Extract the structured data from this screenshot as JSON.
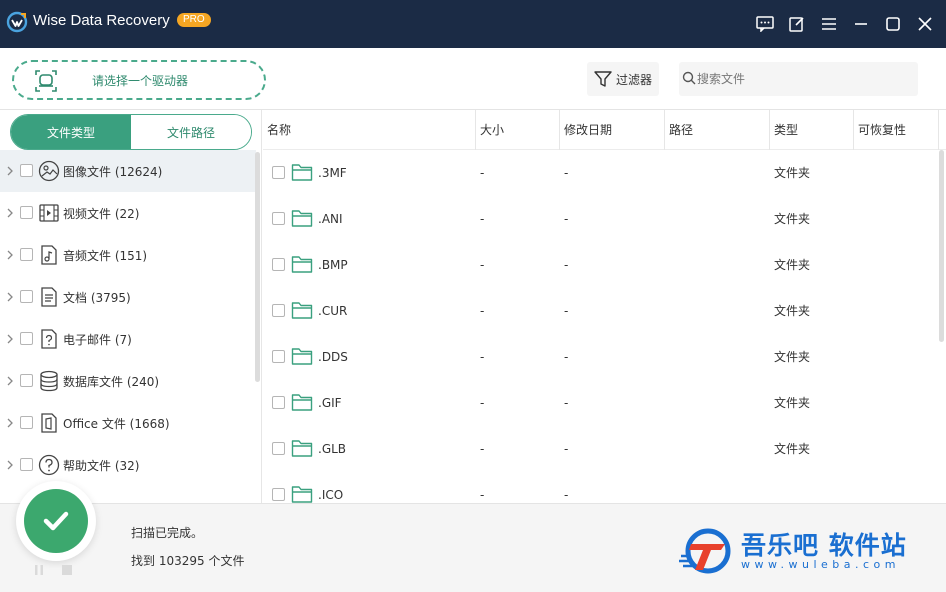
{
  "window": {
    "title": "Wise Data Recovery",
    "badge": "PRO"
  },
  "toolbar": {
    "drive_select_label": "请选择一个驱动器",
    "filter_label": "过滤器",
    "search_placeholder": "搜索文件"
  },
  "left_panel": {
    "tabs": [
      {
        "label": "文件类型",
        "active": true
      },
      {
        "label": "文件路径",
        "active": false
      }
    ],
    "categories": [
      {
        "label": "图像文件 (12624)",
        "icon": "image-icon"
      },
      {
        "label": "视频文件 (22)",
        "icon": "video-icon"
      },
      {
        "label": "音频文件 (151)",
        "icon": "audio-icon"
      },
      {
        "label": "文档 (3795)",
        "icon": "document-icon"
      },
      {
        "label": "电子邮件 (7)",
        "icon": "email-icon"
      },
      {
        "label": "数据库文件 (240)",
        "icon": "database-icon"
      },
      {
        "label": "Office 文件 (1668)",
        "icon": "office-icon"
      },
      {
        "label": "帮助文件 (32)",
        "icon": "help-icon"
      }
    ]
  },
  "table": {
    "columns": [
      "名称",
      "大小",
      "修改日期",
      "路径",
      "类型",
      "可恢复性"
    ],
    "rows": [
      {
        "name": ".3MF",
        "size": "-",
        "modified": "-",
        "path": "",
        "type": "文件夹",
        "recoverability": ""
      },
      {
        "name": ".ANI",
        "size": "-",
        "modified": "-",
        "path": "",
        "type": "文件夹",
        "recoverability": ""
      },
      {
        "name": ".BMP",
        "size": "-",
        "modified": "-",
        "path": "",
        "type": "文件夹",
        "recoverability": ""
      },
      {
        "name": ".CUR",
        "size": "-",
        "modified": "-",
        "path": "",
        "type": "文件夹",
        "recoverability": ""
      },
      {
        "name": ".DDS",
        "size": "-",
        "modified": "-",
        "path": "",
        "type": "文件夹",
        "recoverability": ""
      },
      {
        "name": ".GIF",
        "size": "-",
        "modified": "-",
        "path": "",
        "type": "文件夹",
        "recoverability": ""
      },
      {
        "name": ".GLB",
        "size": "-",
        "modified": "-",
        "path": "",
        "type": "文件夹",
        "recoverability": ""
      },
      {
        "name": ".ICO",
        "size": "-",
        "modified": "-",
        "path": "",
        "type": "",
        "recoverability": ""
      }
    ]
  },
  "status": {
    "line1": "扫描已完成。",
    "line2": "找到 103295 个文件"
  },
  "watermark": {
    "title": "吾乐吧 软件站",
    "url": "www.wuleba.com"
  },
  "colors": {
    "titlebar": "#1b2b45",
    "accent": "#3aa07f",
    "success": "#3ca86e",
    "folder": "#3aa07f",
    "watermark": "#1a6fd1"
  }
}
